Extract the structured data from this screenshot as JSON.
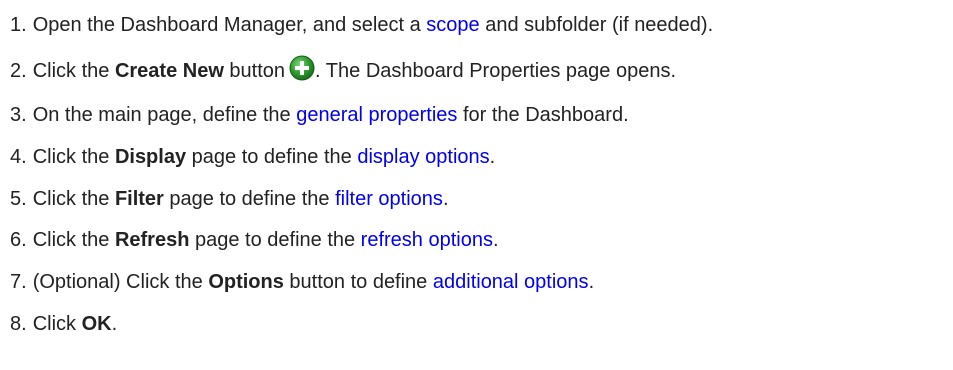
{
  "steps": [
    {
      "num": "1.",
      "t1": "Open the Dashboard Manager, and select a ",
      "link": "scope",
      "t2": " and subfolder (if needed)."
    },
    {
      "num": "2.",
      "t1": "Click the ",
      "bold": "Create New",
      "t2": " button",
      "t3": ". The Dashboard Properties page opens.",
      "icon": "add-icon"
    },
    {
      "num": "3.",
      "t1": "On the main page, define the ",
      "link": "general properties",
      "t2": " for the Dashboard."
    },
    {
      "num": "4.",
      "t1": "Click the ",
      "bold": "Display",
      "t2": " page to define the ",
      "link": "display options",
      "t3": "."
    },
    {
      "num": "5.",
      "t1": "Click the ",
      "bold": "Filter",
      "t2": " page to define the ",
      "link": "filter options",
      "t3": "."
    },
    {
      "num": "6.",
      "t1": "Click the ",
      "bold": "Refresh",
      "t2": " page to define the ",
      "link": "refresh options",
      "t3": "."
    },
    {
      "num": "7.",
      "t1": "(Optional) Click the ",
      "bold": "Options",
      "t2": " button to define ",
      "link": "additional options",
      "t3": "."
    },
    {
      "num": "8.",
      "t1": "Click ",
      "bold": "OK",
      "t2": "."
    }
  ],
  "colors": {
    "text": "#222222",
    "link": "#0000ee",
    "icon": "#2e9b2e"
  }
}
